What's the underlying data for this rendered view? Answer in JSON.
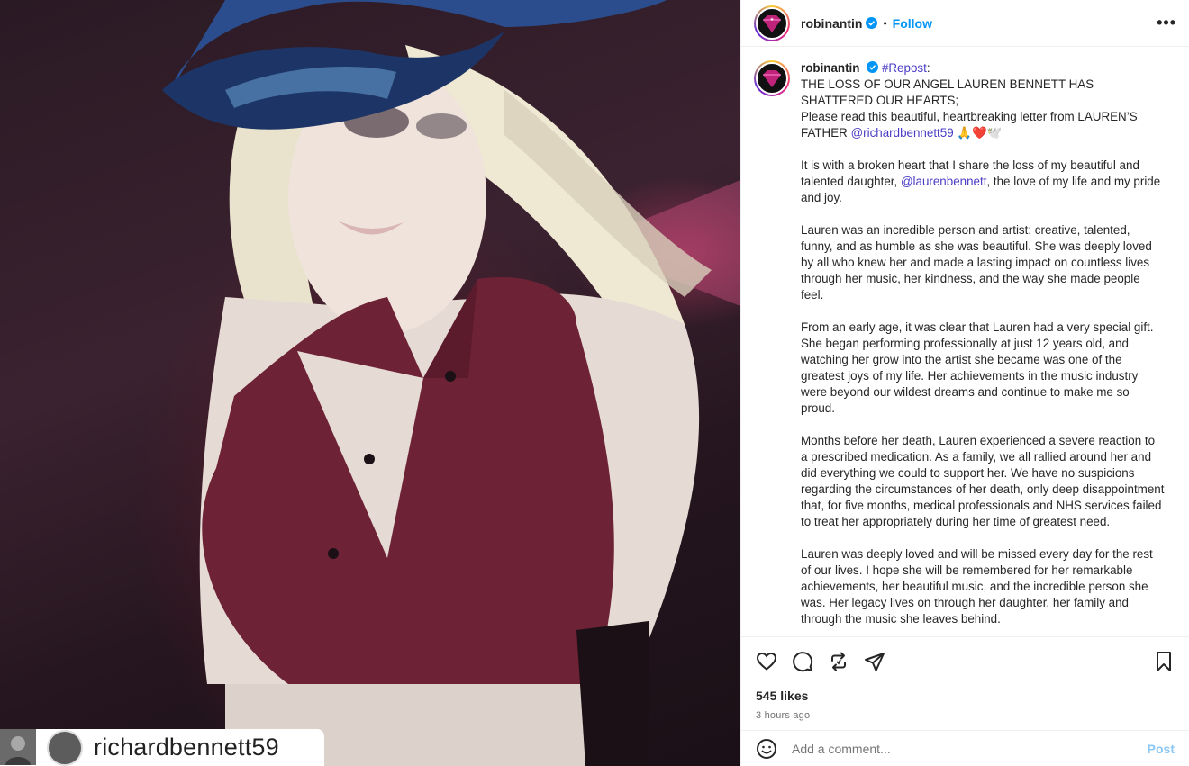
{
  "media": {
    "repost_username": "richardbennett59",
    "icons": [
      "repost-icon",
      "avatar"
    ]
  },
  "header": {
    "username": "robinantin",
    "follow_label": "Follow",
    "more_label": "•••"
  },
  "caption": {
    "username": "robinantin",
    "repost_tag": "#Repost",
    "colon": ":",
    "line1": "THE LOSS OF OUR ANGEL LAUREN BENNETT HAS SHATTERED OUR HEARTS;",
    "line2_prefix": "Please read this beautiful, heartbreaking letter from LAUREN’S FATHER ",
    "line2_mention": "@richardbennett59",
    "line2_emoji": " 🙏❤️🕊️",
    "p1_prefix": "It is with a broken heart that I share the loss of my beautiful and talented daughter, ",
    "p1_mention": "@laurenbennett",
    "p1_suffix": ", the love of my life and my pride and joy.",
    "p2": "Lauren was an incredible person and artist: creative, talented, funny, and as humble as she was beautiful. She was deeply loved by all who knew her and made a lasting impact on countless lives through her music, her kindness, and the way she made people feel.",
    "p3": "From an early age, it was clear that Lauren had a very special gift. She began performing professionally at just 12 years old, and watching her grow into the artist she became was one of the greatest joys of my life. Her achievements in the music industry were beyond our wildest dreams and continue to make me so proud.",
    "p4": "Months before her death, Lauren experienced a severe reaction to a prescribed medication. As a family, we all rallied around her and did everything we could to support her. We have no suspicions regarding the circumstances of her death, only deep disappointment that, for five months, medical professionals and NHS services failed to treat her appropriately during her time of greatest need.",
    "p5": "Lauren was deeply loved and will be missed every day for the rest of our lives. I hope she will be remembered for her remarkable achievements, her beautiful music, and the incredible person she was. Her legacy lives on through her daughter, her family and through the music she leaves behind."
  },
  "actions": {
    "likes": "545 likes",
    "time": "3 hours ago"
  },
  "comment": {
    "placeholder": "Add a comment...",
    "post_label": "Post"
  },
  "colors": {
    "follow": "#0095f6",
    "mention": "#4a3cc4",
    "post_disabled": "#8cc8f4",
    "verified": "#0095f6"
  }
}
